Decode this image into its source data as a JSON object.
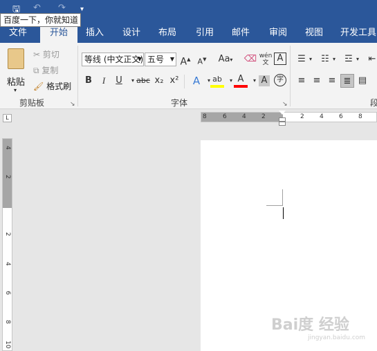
{
  "qat": {
    "save_icon": "save-icon",
    "undo_icon": "undo-icon",
    "redo_icon": "redo-icon",
    "customize_icon": "customize-qat-icon"
  },
  "tooltip": {
    "text": "百度一下，你就知道"
  },
  "tabs": [
    {
      "label": "文件"
    },
    {
      "label": "开始"
    },
    {
      "label": "插入"
    },
    {
      "label": "设计"
    },
    {
      "label": "布局"
    },
    {
      "label": "引用"
    },
    {
      "label": "邮件"
    },
    {
      "label": "审阅"
    },
    {
      "label": "视图"
    },
    {
      "label": "开发工具"
    }
  ],
  "clipboard": {
    "paste": "粘贴",
    "cut": "剪切",
    "copy": "复制",
    "format_painter": "格式刷",
    "group_label": "剪贴板"
  },
  "font": {
    "font_name": "等线 (中文正文)",
    "font_size": "五号",
    "grow": "A",
    "shrink": "A",
    "change_case": "Aa",
    "pinyin": "wén",
    "border_char": "A",
    "bold": "B",
    "italic": "I",
    "underline": "U",
    "strike": "abc",
    "subscript": "x₂",
    "superscript": "x²",
    "text_effect": "A",
    "highlight": "ab",
    "font_color": "A",
    "shading_char": "A",
    "enclose_char": "字",
    "group_label": "字体"
  },
  "paragraph": {
    "group_label": "段"
  },
  "ruler": {
    "corner": "L",
    "h_ticks": [
      "8",
      "6",
      "4",
      "2",
      "2",
      "4",
      "6",
      "8"
    ],
    "v_ticks": [
      "4",
      "2",
      "2",
      "4",
      "6",
      "8",
      "10"
    ]
  },
  "watermark": {
    "text": "Bai度 经验",
    "sub": "jingyan.baidu.com"
  },
  "colors": {
    "title_blue": "#2b579a",
    "highlight_yellow": "#ffff00",
    "font_red": "#ff0000"
  }
}
